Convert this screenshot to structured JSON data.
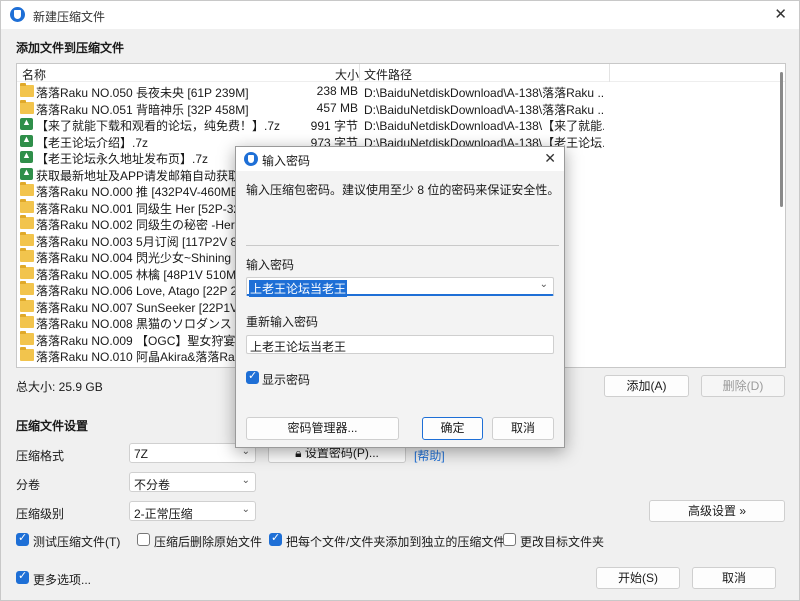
{
  "window": {
    "title": "新建压缩文件",
    "close_icon": "close-icon"
  },
  "add_section": {
    "title": "添加文件到压缩文件"
  },
  "file_list": {
    "columns": {
      "name": "名称",
      "size": "大小",
      "path": "文件路径"
    },
    "rows": [
      {
        "icon": "folder",
        "name": "落落Raku NO.050 長夜未央 [61P 239M]",
        "size": "238 MB",
        "path": "D:\\BaiduNetdiskDownload\\A-138\\落落Raku ..."
      },
      {
        "icon": "folder",
        "name": "落落Raku NO.051 背暗神乐 [32P 458M]",
        "size": "457 MB",
        "path": "D:\\BaiduNetdiskDownload\\A-138\\落落Raku ..."
      },
      {
        "icon": "7z",
        "name": "【来了就能下载和观看的论坛，纯免费！】.7z",
        "size": "991 字节",
        "path": "D:\\BaiduNetdiskDownload\\A-138\\【来了就能..."
      },
      {
        "icon": "7z",
        "name": "【老王论坛介绍】.7z",
        "size": "973 字节",
        "path": "D:\\BaiduNetdiskDownload\\A-138\\【老王论坛..."
      },
      {
        "icon": "7z",
        "name": "【老王论坛永久地址发布页】.7z",
        "size": "",
        "path": "...\\【老王论坛..."
      },
      {
        "icon": "7z",
        "name": "获取最新地址及APP请发邮箱自动获取.7z",
        "size": "",
        "path": "...\\获取最新地..."
      },
      {
        "icon": "folder",
        "name": "落落Raku NO.000 推 [432P4V-460MB]",
        "size": "",
        "path": "Raku ..."
      },
      {
        "icon": "folder",
        "name": "落落Raku NO.001 同级生 Her [52P-323M",
        "size": "",
        "path": "Raku ..."
      },
      {
        "icon": "folder",
        "name": "落落Raku NO.002 同级生の秘密 -Her se",
        "size": "",
        "path": "Raku ..."
      },
      {
        "icon": "folder",
        "name": "落落Raku NO.003 5月订阅 [117P2V 881",
        "size": "",
        "path": "Raku ..."
      },
      {
        "icon": "folder",
        "name": "落落Raku NO.004 閃光少女~Shining Da",
        "size": "",
        "path": "Raku ..."
      },
      {
        "icon": "folder",
        "name": "落落Raku NO.005 林檎 [48P1V 510MB]",
        "size": "",
        "path": "Raku ..."
      },
      {
        "icon": "folder",
        "name": "落落Raku NO.006 Love, Atago [22P 220",
        "size": "",
        "path": "Raku ..."
      },
      {
        "icon": "folder",
        "name": "落落Raku NO.007 SunSeeker [22P1V 17",
        "size": "",
        "path": "Raku ..."
      },
      {
        "icon": "folder",
        "name": "落落Raku NO.008 黒猫のソロダンス [58",
        "size": "",
        "path": "Raku ..."
      },
      {
        "icon": "folder",
        "name": "落落Raku NO.009 【OGC】聖女狩宴[15P",
        "size": "",
        "path": "Raku ..."
      },
      {
        "icon": "folder",
        "name": "落落Raku NO.010 阿晶Akira&落落Raku",
        "size": "",
        "path": "Raku ..."
      }
    ]
  },
  "total_size": "总大小: 25.9 GB",
  "list_buttons": {
    "add": "添加(A)",
    "delete": "删除(D)"
  },
  "settings": {
    "title": "压缩文件设置",
    "format_label": "压缩格式",
    "format_value": "7Z",
    "volume_label": "分卷",
    "volume_value": "不分卷",
    "level_label": "压缩级别",
    "level_value": "2-正常压缩",
    "set_password_button": "设置密码(P)...",
    "help_link": "[帮助]",
    "advanced_button": "高级设置 »"
  },
  "options": {
    "test": {
      "label": "测试压缩文件(T)",
      "checked": true
    },
    "delete_source": {
      "label": "压缩后删除原始文件",
      "checked": false
    },
    "each_separate": {
      "label": "把每个文件/文件夹添加到独立的压缩文件",
      "checked": true
    },
    "change_target": {
      "label": "更改目标文件夹",
      "checked": false
    },
    "more_options": {
      "label": "更多选项...",
      "checked": true
    }
  },
  "bottom_buttons": {
    "start": "开始(S)",
    "cancel": "取消"
  },
  "dialog": {
    "title": "输入密码",
    "hint": "输入压缩包密码。建议使用至少 8 位的密码来保证安全性。",
    "password_label": "输入密码",
    "password_value": "上老王论坛当老王",
    "confirm_label": "重新输入密码",
    "confirm_value": "上老王论坛当老王",
    "show_password": {
      "label": "显示密码",
      "checked": true
    },
    "manager_button": "密码管理器...",
    "ok_button": "确定",
    "cancel_button": "取消"
  },
  "colors": {
    "accent": "#1e6fd6",
    "folder": "#f2c44d",
    "archive": "#2f8f4a"
  }
}
